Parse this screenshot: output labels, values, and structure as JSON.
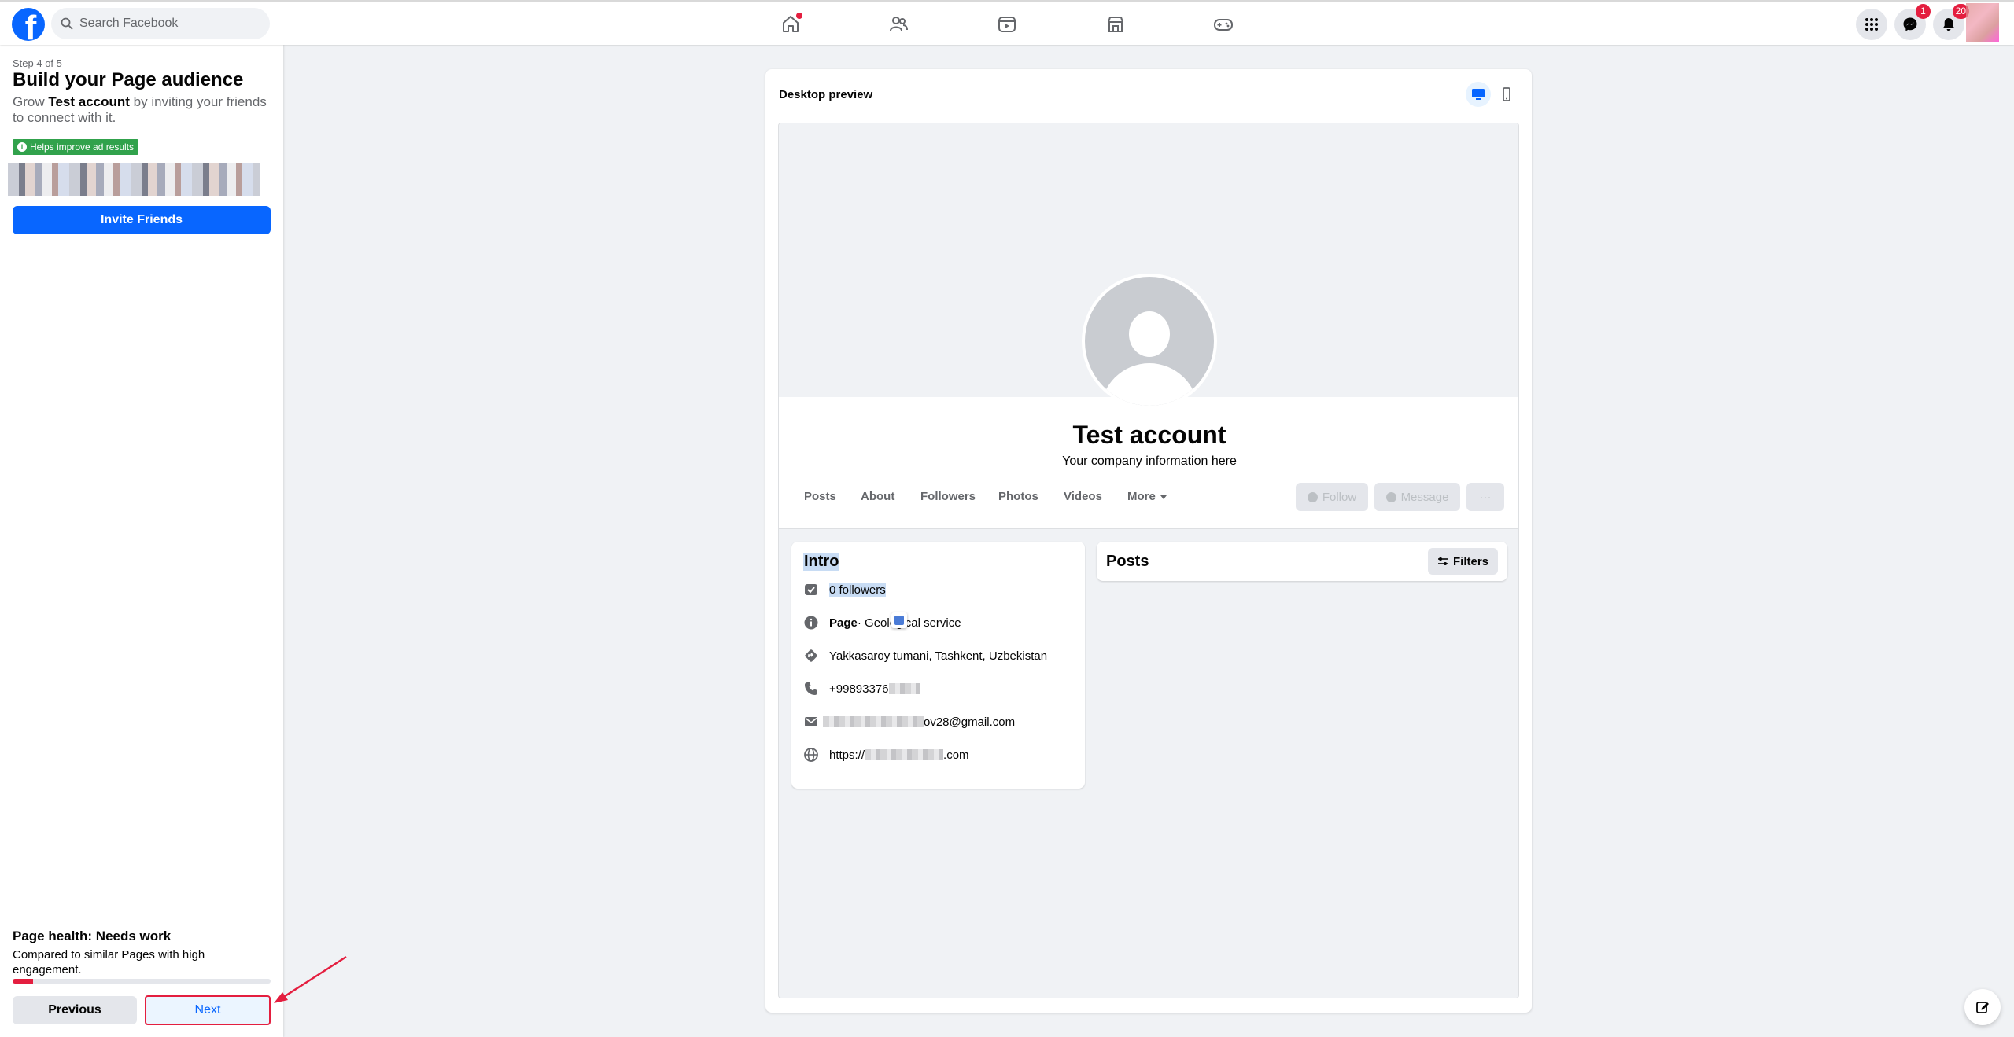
{
  "topbar": {
    "search_placeholder": "Search Facebook",
    "messenger_badge": "1",
    "notifications_badge": "20"
  },
  "sidebar": {
    "step": "Step 4 of 5",
    "title": "Build your Page audience",
    "desc_prefix": "Grow ",
    "desc_page": "Test account",
    "desc_suffix": " by inviting your friends to connect with it.",
    "help_badge": "Helps improve ad results",
    "invite_label": "Invite Friends"
  },
  "health": {
    "title": "Page health: Needs work",
    "desc": "Compared to similar Pages with high engagement.",
    "progress_fraction": 0.08,
    "previous_label": "Previous",
    "next_label": "Next"
  },
  "preview": {
    "label": "Desktop preview",
    "page_name": "Test account",
    "page_sub": "Your company information here",
    "tabs": [
      "Posts",
      "About",
      "Followers",
      "Photos",
      "Videos",
      "More"
    ],
    "follow_label": "Follow",
    "message_label": "Message",
    "more_label": "···",
    "intro": {
      "title": "Intro",
      "followers": "0 followers",
      "page_label": "Page",
      "category": " · Geological service",
      "address": "Yakkasaroy tumani, Tashkent, Uzbekistan",
      "phone": "+99893376",
      "email_suffix": "ov28@gmail.com",
      "website_prefix": "https://",
      "website_suffix": ".com"
    },
    "posts": {
      "title": "Posts",
      "filters_label": "Filters"
    }
  },
  "colors": {
    "brand": "#0866ff",
    "alert": "#e41e3f",
    "success": "#31a24c"
  }
}
